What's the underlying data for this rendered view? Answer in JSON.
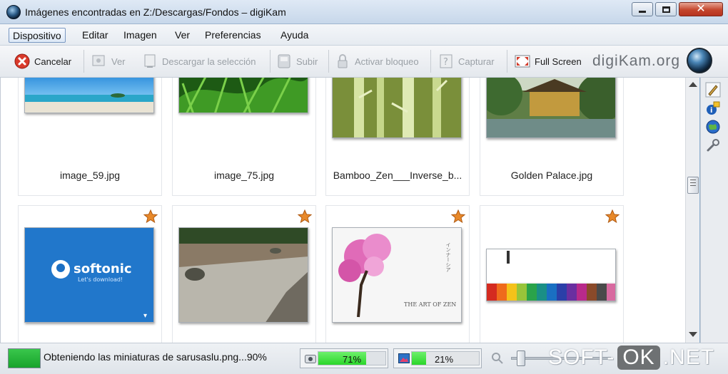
{
  "window": {
    "title": "Imágenes encontradas en Z:/Descargas/Fondos – digiKam",
    "buttons": {
      "minimize": "minimize-icon",
      "maximize": "maximize-icon",
      "close": "close-icon"
    }
  },
  "menu": {
    "items": [
      {
        "label": "Dispositivo",
        "active": true
      },
      {
        "label": "Editar"
      },
      {
        "label": "Imagen"
      },
      {
        "label": "Ver"
      },
      {
        "label": "Preferencias"
      },
      {
        "label": "Ayuda"
      }
    ]
  },
  "toolbar": {
    "cancel": "Cancelar",
    "view": "Ver",
    "download_selection": "Descargar la selección",
    "upload": "Subir",
    "lock": "Activar bloqueo",
    "capture": "Capturar",
    "fullscreen": "Full Screen",
    "brand": "digiKam.org"
  },
  "thumbnails": [
    {
      "label": "image_59.jpg",
      "starred": false,
      "image": "beach-sea"
    },
    {
      "label": "image_75.jpg",
      "starred": false,
      "image": "green-grass"
    },
    {
      "label": "Bamboo_Zen___Inverse_b...",
      "starred": false,
      "image": "bamboo"
    },
    {
      "label": "Golden Palace.jpg",
      "starred": false,
      "image": "golden-pavilion"
    },
    {
      "label": "",
      "starred": true,
      "image": "softonic-wallpaper",
      "overlay_title": "softonic",
      "overlay_sub": "Let's download!"
    },
    {
      "label": "",
      "starred": true,
      "image": "zen-garden"
    },
    {
      "label": "",
      "starred": true,
      "image": "cherry-tree",
      "overlay_title": "THE ART OF ZEN",
      "overlay_vertical": "インナーシア"
    },
    {
      "label": "",
      "starred": true,
      "image": "colored-pencils"
    }
  ],
  "status": {
    "message": "Obteniendo las miniaturas de sarusaslu.png...90%",
    "progress1_label": "71%",
    "progress1_value": 0.71,
    "progress2_label": "21%",
    "progress2_value": 0.21,
    "indicator_color": "#1fae33"
  },
  "watermark": {
    "left": "SOFT-",
    "mid": "OK",
    "right": ".NET"
  },
  "colors": {
    "accent": "#2b5a86",
    "star": "#e8892a",
    "progress": "#36dc34"
  }
}
